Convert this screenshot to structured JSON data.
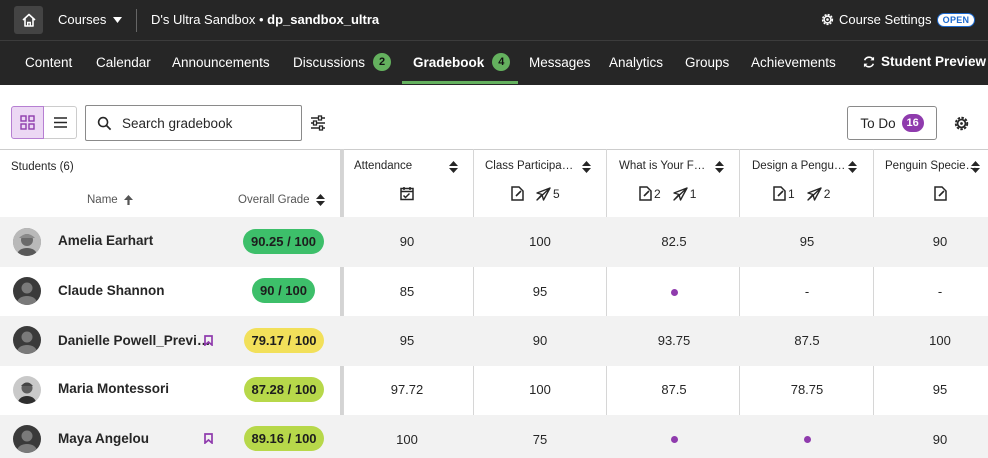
{
  "topbar": {
    "courses_label": "Courses",
    "course_name": "D's Ultra Sandbox",
    "course_id": "dp_sandbox_ultra",
    "course_settings_label": "Course Settings",
    "open_badge": "OPEN"
  },
  "nav": {
    "items": [
      {
        "label": "Content"
      },
      {
        "label": "Calendar"
      },
      {
        "label": "Announcements"
      },
      {
        "label": "Discussions",
        "badge": "2"
      },
      {
        "label": "Gradebook",
        "badge": "4",
        "active": true
      },
      {
        "label": "Messages"
      },
      {
        "label": "Analytics"
      },
      {
        "label": "Groups"
      },
      {
        "label": "Achievements"
      }
    ],
    "student_preview_label": "Student Preview"
  },
  "toolbar": {
    "search_placeholder": "Search gradebook",
    "todo_label": "To Do",
    "todo_count": "16"
  },
  "grid": {
    "students_label": "Students (6)",
    "name_header": "Name",
    "overall_grade_header": "Overall Grade",
    "columns": [
      {
        "title": "Attendance"
      },
      {
        "title": "Class Participa…",
        "icon_counts": [
          "5"
        ]
      },
      {
        "title": "What is Your F…",
        "icon_counts": [
          "2",
          "1"
        ]
      },
      {
        "title": "Design a Pengu…",
        "icon_counts": [
          "1",
          "2"
        ]
      },
      {
        "title": "Penguin Specie…"
      }
    ],
    "rows": [
      {
        "name": "Amelia Earhart",
        "grade": "90.25 / 100",
        "grade_color": "#3dbf6a",
        "values": [
          "90",
          "100",
          "82.5",
          "95",
          "90"
        ]
      },
      {
        "name": "Claude Shannon",
        "grade": "90 / 100",
        "grade_color": "#3dbf6a",
        "values": [
          "85",
          "95",
          "",
          "-",
          "-"
        ]
      },
      {
        "name": "Danielle Powell_Previ…",
        "grade": "79.17 / 100",
        "grade_color": "#f2e05a",
        "values": [
          "95",
          "90",
          "93.75",
          "87.5",
          "100"
        ]
      },
      {
        "name": "Maria Montessori",
        "grade": "87.28 / 100",
        "grade_color": "#b7d84a",
        "values": [
          "97.72",
          "100",
          "87.5",
          "78.75",
          "95"
        ]
      },
      {
        "name": "Maya Angelou",
        "grade": "89.16 / 100",
        "grade_color": "#b7d84a",
        "values": [
          "100",
          "75",
          "",
          "",
          "90"
        ]
      }
    ]
  },
  "colors": {
    "nav_bg": "#262626",
    "accent_green": "#64b15e",
    "accent_purple": "#8f3bad"
  }
}
